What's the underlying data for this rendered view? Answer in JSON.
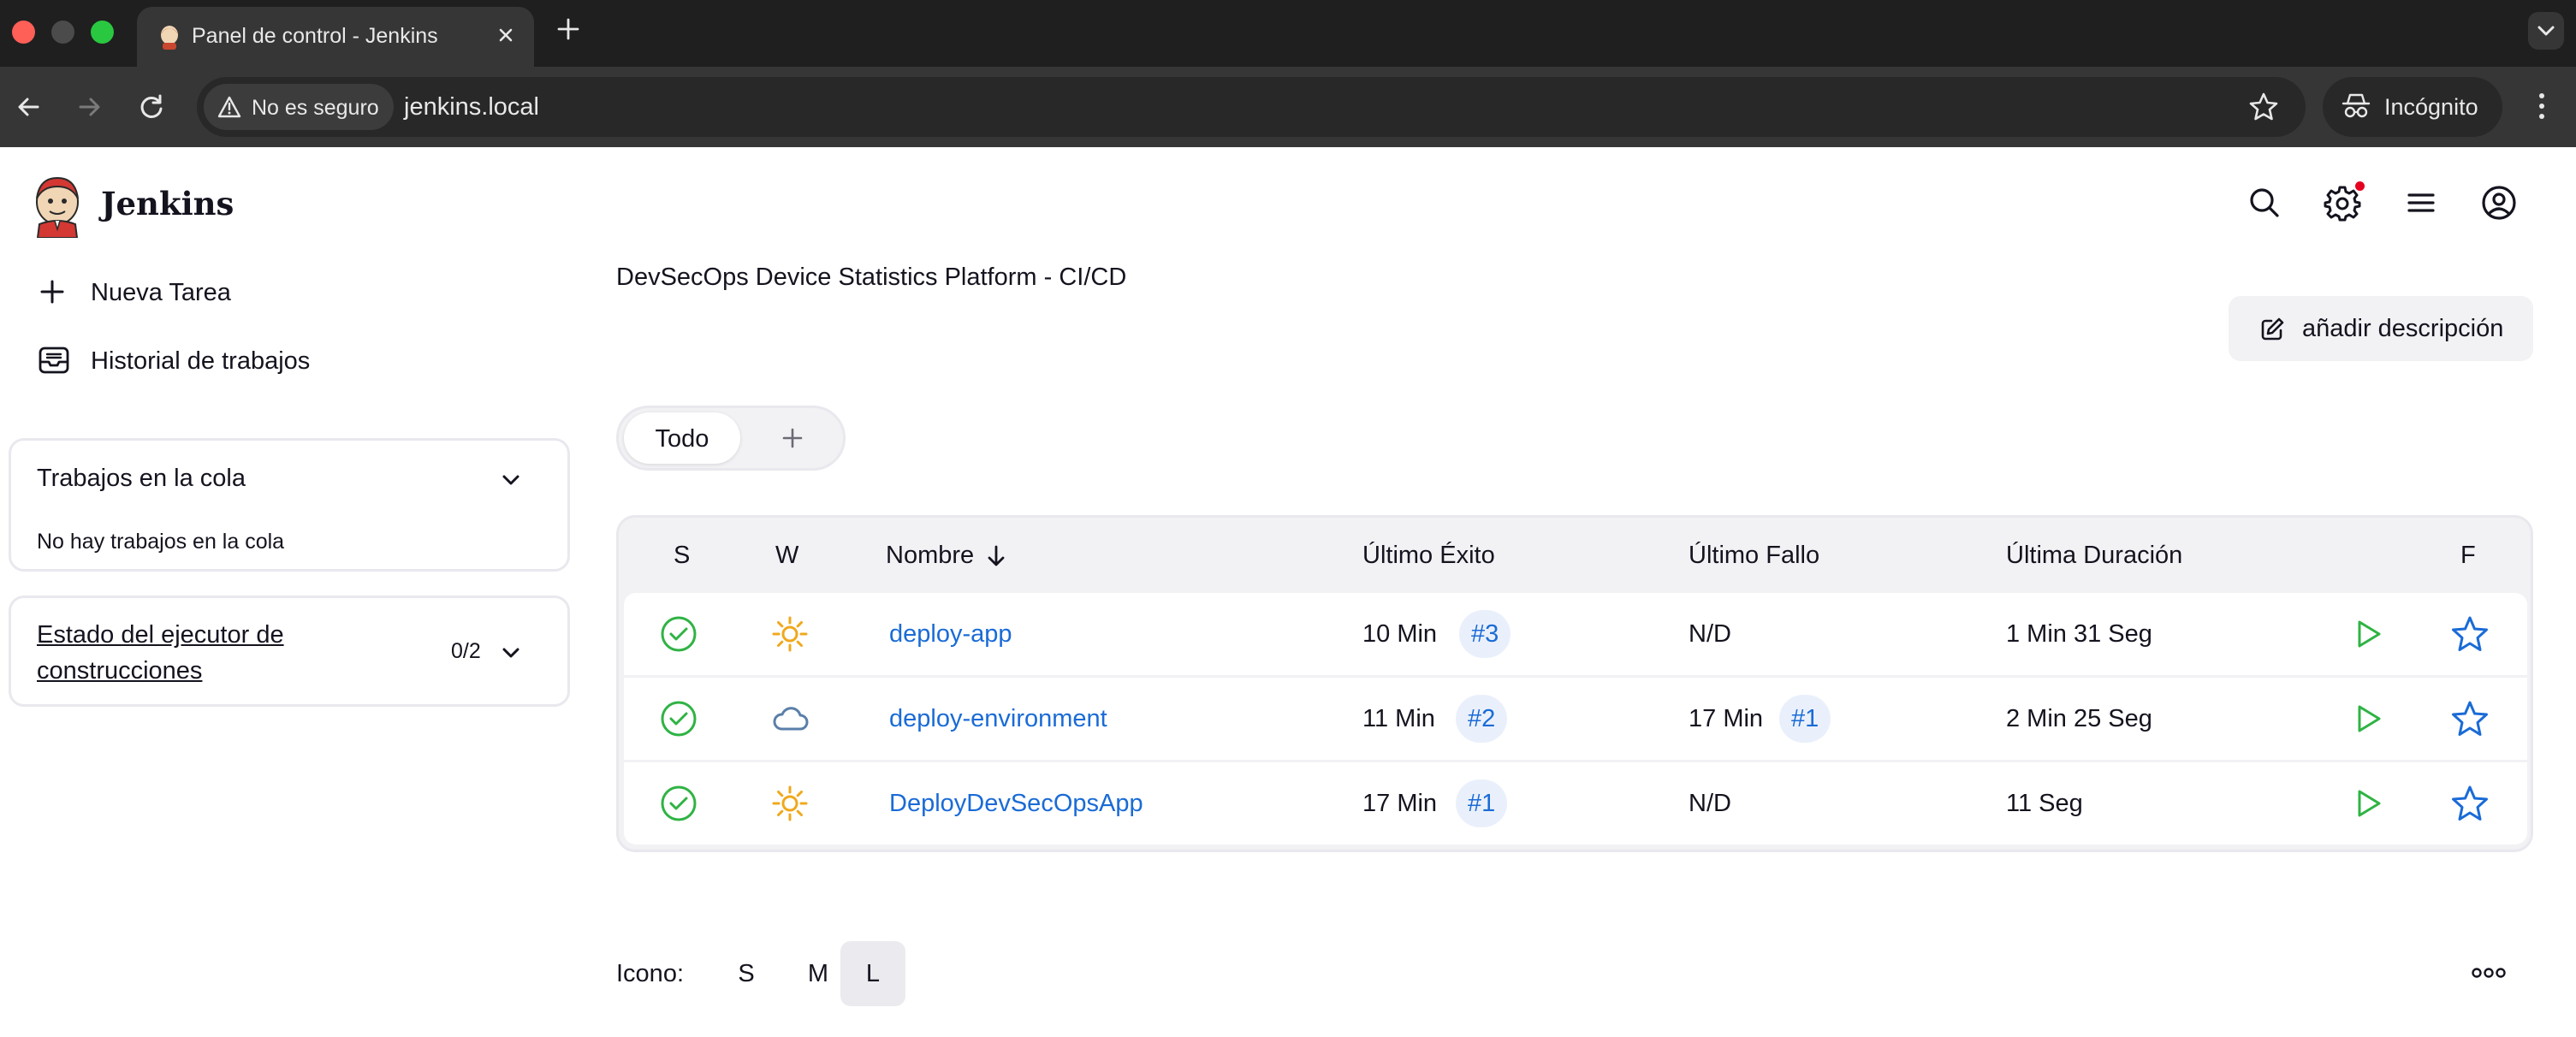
{
  "browser": {
    "tab_title": "Panel de control - Jenkins",
    "security_label": "No es seguro",
    "url": "jenkins.local",
    "profile_label": "Incógnito"
  },
  "header": {
    "brand": "Jenkins"
  },
  "sidebar": {
    "links": [
      {
        "label": "Nueva Tarea",
        "icon": "plus-icon"
      },
      {
        "label": "Historial de trabajos",
        "icon": "inbox-icon"
      }
    ],
    "queue": {
      "title": "Trabajos en la cola",
      "empty_text": "No hay trabajos en la cola"
    },
    "executors": {
      "title": "Estado del ejecutor de construcciones",
      "count": "0/2"
    }
  },
  "main": {
    "description": "DevSecOps Device Statistics Platform - CI/CD",
    "add_description_label": "añadir descripción",
    "views": {
      "active": "Todo"
    },
    "table": {
      "headers": {
        "status": "S",
        "weather": "W",
        "name": "Nombre",
        "last_success": "Último Éxito",
        "last_failure": "Último Fallo",
        "last_duration": "Última Duración",
        "favorite": "F"
      },
      "rows": [
        {
          "status": "success",
          "weather": "sunny",
          "name": "deploy-app",
          "last_success": "10 Min",
          "last_success_build": "#3",
          "last_failure": "N/D",
          "last_failure_build": "",
          "duration": "1 Min 31 Seg"
        },
        {
          "status": "success",
          "weather": "cloudy",
          "name": "deploy-environment",
          "last_success": "11 Min",
          "last_success_build": "#2",
          "last_failure": "17 Min",
          "last_failure_build": "#1",
          "duration": "2 Min 25 Seg"
        },
        {
          "status": "success",
          "weather": "sunny",
          "name": "DeployDevSecOpsApp",
          "last_success": "17 Min",
          "last_success_build": "#1",
          "last_failure": "N/D",
          "last_failure_build": "",
          "duration": "11 Seg"
        }
      ]
    },
    "icon_size": {
      "label": "Icono:",
      "options": [
        "S",
        "M",
        "L"
      ],
      "selected": "L"
    }
  },
  "colors": {
    "success": "#2fb344",
    "link": "#1a6bd6",
    "sunny": "#f0a81c",
    "cloudy": "#5a7fa8",
    "notification": "#e6001f"
  }
}
